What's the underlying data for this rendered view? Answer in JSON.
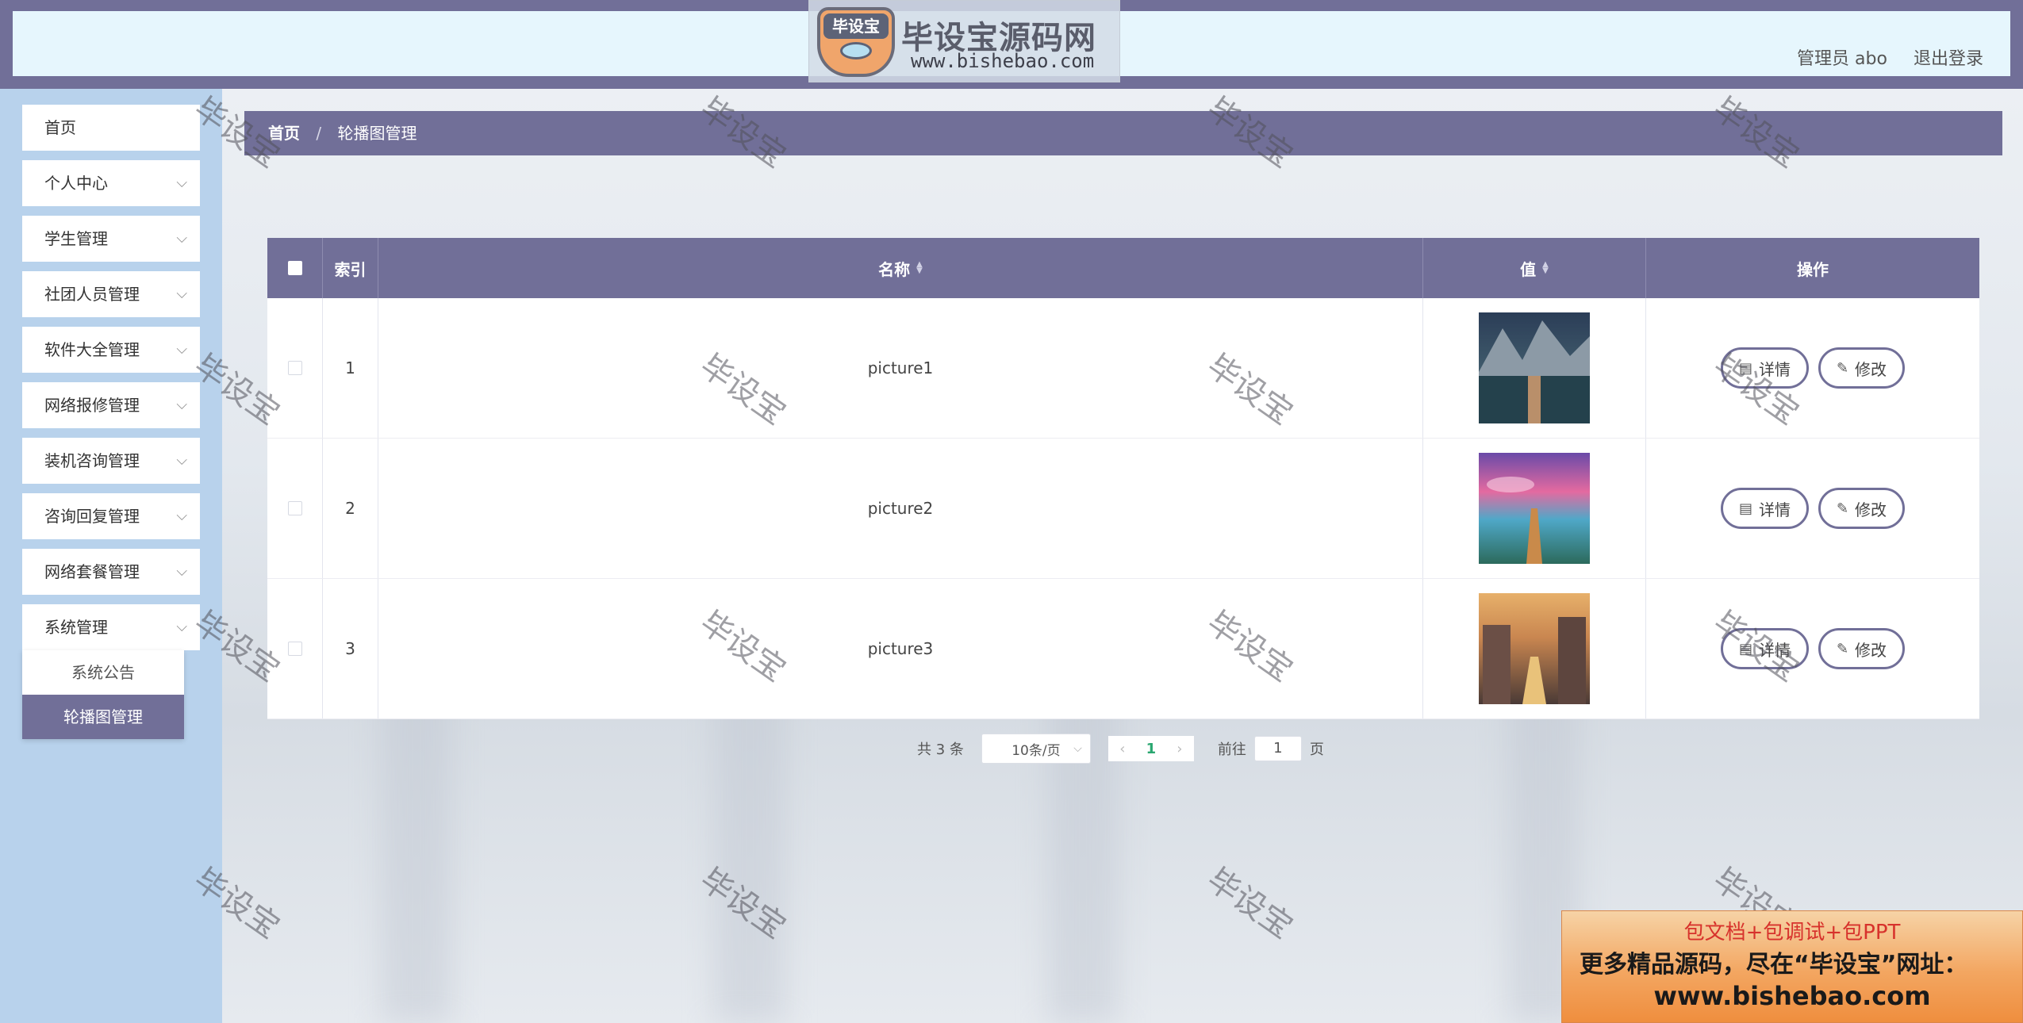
{
  "header": {
    "logo_badge": "毕设宝",
    "logo_title": "毕设宝源码网",
    "logo_url": "www.bishebao.com",
    "user": "管理员 abo",
    "logout": "退出登录"
  },
  "sidebar": {
    "items": [
      {
        "label": "首页"
      },
      {
        "label": "个人中心"
      },
      {
        "label": "学生管理"
      },
      {
        "label": "社团人员管理"
      },
      {
        "label": "软件大全管理"
      },
      {
        "label": "网络报修管理"
      },
      {
        "label": "装机咨询管理"
      },
      {
        "label": "咨询回复管理"
      },
      {
        "label": "网络套餐管理"
      },
      {
        "label": "系统管理"
      }
    ],
    "submenu": [
      {
        "label": "系统公告"
      },
      {
        "label": "轮播图管理"
      }
    ]
  },
  "breadcrumb": {
    "home": "首页",
    "separator": "/",
    "current": "轮播图管理"
  },
  "table": {
    "headers": {
      "index": "索引",
      "name": "名称",
      "value": "值",
      "actions": "操作"
    },
    "rows": [
      {
        "index": "1",
        "name": "picture1"
      },
      {
        "index": "2",
        "name": "picture2"
      },
      {
        "index": "3",
        "name": "picture3"
      }
    ],
    "detail_label": "详情",
    "edit_label": "修改"
  },
  "pagination": {
    "total": "共 3 条",
    "page_size": "10条/页",
    "current_page": "1",
    "goto_label": "前往",
    "goto_value": "1",
    "page_suffix": "页"
  },
  "watermark": "毕设宝",
  "promo": {
    "line1": "包文档+包调试+包PPT",
    "line2": "更多精品源码，尽在“毕设宝”网址：",
    "line3": "www.bishebao.com"
  },
  "colors": {
    "primary": "#716f98",
    "header_bg": "#e6f6fd",
    "sidebar_bg": "#b8d2ec",
    "page_active": "#2aa770"
  }
}
